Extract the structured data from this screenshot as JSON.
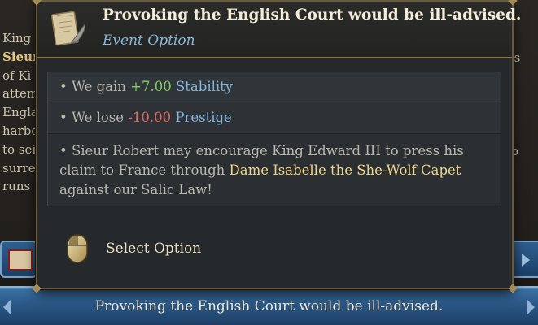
{
  "background": {
    "left_text_lines": [
      {
        "text": "King",
        "highlight": false
      },
      {
        "text": "Sieur",
        "highlight": true
      },
      {
        "text": "of Ki",
        "highlight": false,
        "hl_suffix": true
      },
      {
        "text": "attem",
        "highlight": false
      },
      {
        "text": "Engla",
        "highlight": false
      },
      {
        "text": "harbo",
        "highlight": false
      },
      {
        "text": "to seize",
        "highlight": false
      },
      {
        "text": "surre",
        "highlight": false
      },
      {
        "text": "runs",
        "highlight": false
      }
    ],
    "right_text_lines": [
      "ns",
      "to"
    ],
    "bottom_bar_caption": "Provoking the English Court would be ill-advised."
  },
  "tooltip": {
    "title": "Provoking the English Court would be ill-advised.",
    "subtitle": "Event Option",
    "effects": [
      {
        "prefix": "• We gain ",
        "value": "+7.00",
        "value_type": "positive",
        "stat": "Stability"
      },
      {
        "prefix": "• We lose ",
        "value": "-10.00",
        "value_type": "negative",
        "stat": "Prestige"
      }
    ],
    "description": {
      "part1": "• Sieur Robert may encourage King Edward III to press his claim to France through ",
      "character": "Dame Isabelle the She-Wolf Capet",
      "part2": " against our Salic Law!"
    },
    "action": {
      "icon": "mouse-left-click-icon",
      "label": "Select Option"
    }
  },
  "colors": {
    "positive": "#7ccf5e",
    "negative": "#dc6a62",
    "stat_link": "#84b7dd",
    "character_link": "#f0d48a",
    "subtitle": "#86b8dc",
    "accent_border": "#8c7548",
    "bar_blue": "#2b5886"
  }
}
